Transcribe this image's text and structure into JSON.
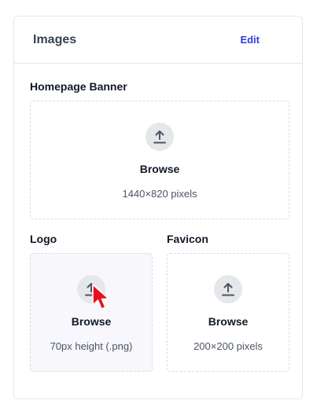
{
  "card": {
    "title": "Images",
    "edit_label": "Edit"
  },
  "homepage_banner": {
    "label": "Homepage Banner",
    "browse_label": "Browse",
    "hint": "1440×820 pixels"
  },
  "logo": {
    "label": "Logo",
    "browse_label": "Browse",
    "hint": "70px height (.png)"
  },
  "favicon": {
    "label": "Favicon",
    "browse_label": "Browse",
    "hint": "200×200 pixels"
  },
  "icons": {
    "upload": "upload-arrow-icon",
    "cursor": "mouse-pointer-icon"
  },
  "colors": {
    "accent": "#2f3bd6",
    "cursor": "#e8101a"
  }
}
